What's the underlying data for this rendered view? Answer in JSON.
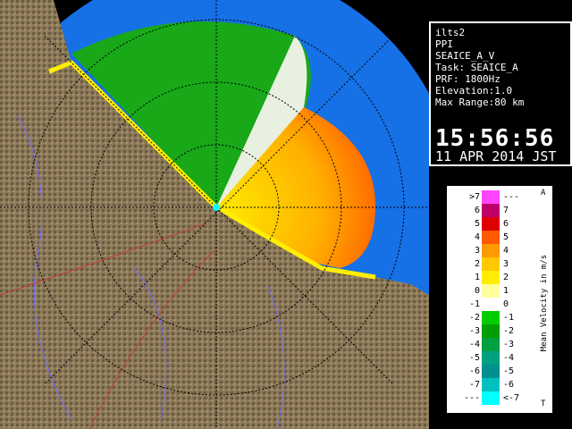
{
  "info": {
    "site": "ilts2",
    "product": "PPI",
    "dataset": "SEAICE_A_V",
    "task": "Task: SEAICE_A",
    "prf": "PRF: 1800Hz",
    "elevation": "Elevation:1.0",
    "max_range": "Max Range:80 km",
    "time": "15:56:56",
    "date": "11 APR 2014 JST"
  },
  "legend": {
    "title": "Mean Velocity in m/s",
    "edge_top": "A",
    "edge_bottom": "T",
    "rows": [
      {
        "left": ">7",
        "right": "---",
        "color": "#ff44ff"
      },
      {
        "left": "6",
        "right": "7",
        "color": "#c0006a"
      },
      {
        "left": "5",
        "right": "6",
        "color": "#e00000"
      },
      {
        "left": "4",
        "right": "5",
        "color": "#ff5a00"
      },
      {
        "left": "3",
        "right": "4",
        "color": "#ff9a00"
      },
      {
        "left": "2",
        "right": "3",
        "color": "#ffc800"
      },
      {
        "left": "1",
        "right": "2",
        "color": "#ffee00"
      },
      {
        "left": "0",
        "right": "1",
        "color": "#ffffa0"
      },
      {
        "left": "-1",
        "right": "0",
        "color": "#ffffff"
      },
      {
        "left": "-2",
        "right": "-1",
        "color": "#00cc00"
      },
      {
        "left": "-3",
        "right": "-2",
        "color": "#009e00"
      },
      {
        "left": "-4",
        "right": "-3",
        "color": "#00a040"
      },
      {
        "left": "-5",
        "right": "-4",
        "color": "#00a080"
      },
      {
        "left": "-6",
        "right": "-5",
        "color": "#009090"
      },
      {
        "left": "-7",
        "right": "-6",
        "color": "#00c0c0"
      },
      {
        "left": "---",
        "right": "<-7",
        "color": "#00ffff"
      }
    ]
  },
  "colors": {
    "background": "#000000",
    "range_disk": "#1670e6",
    "terrain": "#8c7a5a",
    "coast_echo": "#ffee00",
    "approach_echo": "#1ea81e",
    "recede_echo": "#ffa500"
  }
}
